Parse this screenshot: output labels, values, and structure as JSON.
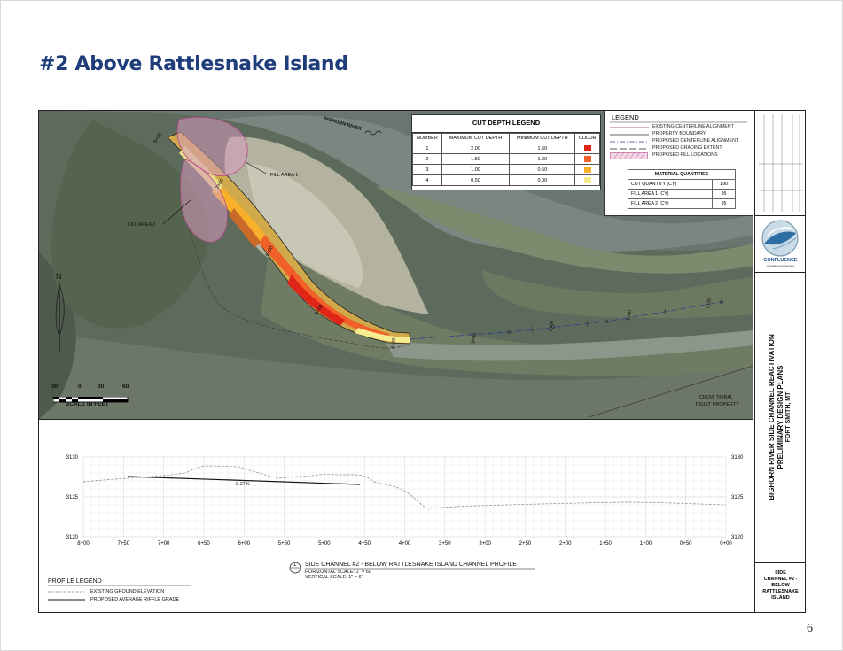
{
  "slide": {
    "title": "#2 Above Rattlesnake Island",
    "page_number": "6"
  },
  "map": {
    "river_label": "BIGHORN RIVER",
    "fill_area_1": "FILL AREA 1",
    "fill_area_2": "FILL AREA 2",
    "property_label_1": "CROW TRIBAL",
    "property_label_2": "TRUST PROPERTY",
    "north_label": "N",
    "scale": {
      "ticks": [
        "30",
        "0",
        "30",
        "60"
      ],
      "caption": "SCALE IN FEET"
    },
    "stations": [
      "0+00",
      "1+00",
      "2+00",
      "3+00",
      "4+00",
      "5+00",
      "6+00",
      "7+00",
      "8+00"
    ]
  },
  "cut_depth_legend": {
    "title": "CUT DEPTH LEGEND",
    "headers": [
      "NUMBER",
      "MAXIMUM CUT DEPTH",
      "MINIMUM CUT DEPTH",
      "COLOR"
    ],
    "rows": [
      {
        "number": "1",
        "max": "2.00",
        "min": "1.50",
        "color": "#e02418"
      },
      {
        "number": "2",
        "max": "1.50",
        "min": "1.00",
        "color": "#f06028"
      },
      {
        "number": "3",
        "max": "1.00",
        "min": "0.50",
        "color": "#f8b02a"
      },
      {
        "number": "4",
        "max": "0.50",
        "min": "0.00",
        "color": "#f8ec90"
      }
    ]
  },
  "legend": {
    "title": "LEGEND",
    "items": [
      "EXISTING CENTERLINE ALIGNMENT",
      "PROPERTY BOUNDARY",
      "PROPOSED CENTERLINE ALIGNMENT",
      "PROPOSED GRADING EXTENT",
      "PROPOSED FILL LOCATIONS"
    ]
  },
  "material_quantities": {
    "title": "MATERIAL QUANTITIES",
    "rows": [
      {
        "label": "CUT QUANTITY (CY)",
        "value": "190"
      },
      {
        "label": "FILL AREA 1 (CY)",
        "value": "95"
      },
      {
        "label": "FILL AREA 2 (CY)",
        "value": "95"
      }
    ]
  },
  "profile": {
    "elevations": [
      "3130",
      "3125",
      "3120"
    ],
    "x_ticks": [
      "8+00",
      "7+50",
      "7+00",
      "6+50",
      "6+00",
      "5+50",
      "5+00",
      "4+50",
      "4+00",
      "3+50",
      "3+00",
      "2+50",
      "2+00",
      "1+50",
      "1+00",
      "0+50",
      "0+00"
    ],
    "grade_label": "0.27%",
    "detail_number": "1",
    "title": "SIDE CHANNEL #2 - BELOW RATTLESNAKE ISLAND CHANNEL PROFILE",
    "horizontal_scale": "HORIZONTAL SCALE: 1\" = 60'",
    "vertical_scale": "VERTICAL SCALE: 1\" = 6'",
    "legend_title": "PROFILE LEGEND",
    "legend_items": [
      "EXISTING GROUND ELEVATION",
      "PROPOSED AVERAGE RIFFLE GRADE"
    ]
  },
  "title_block": {
    "company": "CONFLUENCE",
    "company_sub": "consulting incorporated",
    "project_line1": "BIGHORN RIVER SIDE CHANNEL REACTIVATION",
    "project_line2": "PRELIMINARY DESIGN PLANS",
    "project_line3": "FORT SMITH, MT",
    "sheet_line1": "SIDE",
    "sheet_line2": "CHANNEL #2 -",
    "sheet_line3": "BELOW",
    "sheet_line4": "RATTLESNAKE",
    "sheet_line5": "ISLAND"
  }
}
